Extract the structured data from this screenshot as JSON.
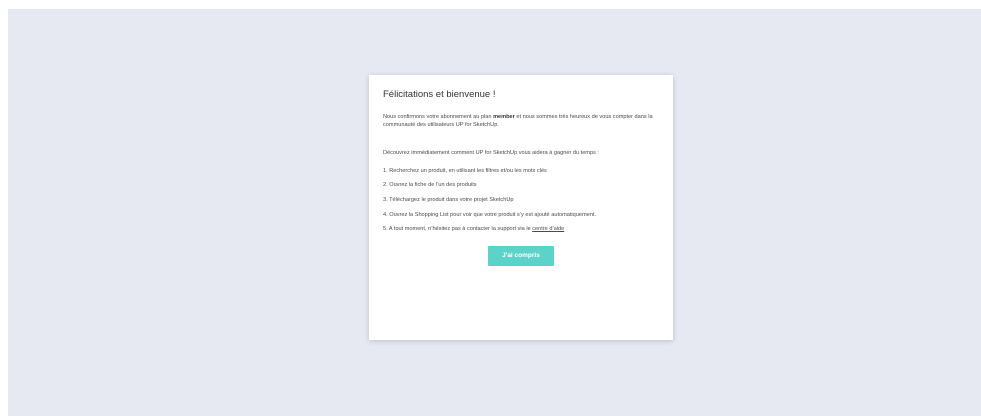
{
  "modal": {
    "title": "Félicitations et bienvenue !",
    "confirm_before": "Nous confirmons votre abonnement au plan ",
    "plan_name": "member",
    "confirm_after": " et nous sommes très heureux de vous compter dans la communauté des utilisateurs UP for SketchUp.",
    "discover": "Découvrez immédiatement comment UP for SketchUp vous aidera à gagner du temps :",
    "steps": [
      "1. Recherchez un produit, en utilisant les filtres et/ou les mots clés",
      "2. Ouvrez la fiche de l’un des produits",
      "3. Téléchargez le produit dans votre projet SketchUp",
      "4. Ouvrez la Shopping List pour voir que votre produit s’y est ajouté automatiquement.",
      "5. A tout moment, n’hésitez pas à contacter la support via le "
    ],
    "help_link": "centre d’aide",
    "button_label": "J'ai compris"
  },
  "colors": {
    "backdrop": "#e6e9f2",
    "accent": "#5cd3c8"
  }
}
